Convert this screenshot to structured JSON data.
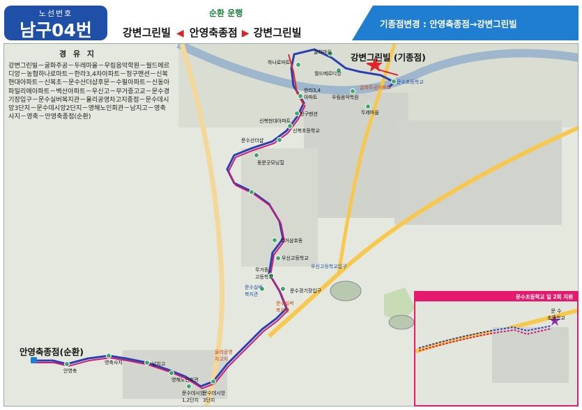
{
  "header": {
    "route_subtitle": "노선번호",
    "route_number": "남구04번",
    "loop_label": "순환 운행",
    "loop_from": "강변그린빌",
    "loop_mid": "안영축종점",
    "loop_to": "강변그린빌",
    "notice": "기종점변경 : 안영축종점→강변그린빌"
  },
  "via": {
    "title": "경 유 지",
    "text": "강변그린빌－굴화주공－두레마을－우림음악학원－월드메르디앙－농협하나로마트－한라3,4차아파트－청구맨션－신복현대아파트－신복초－문수산더샵후문－수필아파트－신동아파밀리에아파트－벽산아파트－우신고－무거중고교－문수경기장입구－문수실버복지관－율리공영차고지종점－문수데시앙3단지－문수데시앙2단지－영해노인회관－남지고－영축사지－영축－안영축종점(순환)"
  },
  "colors": {
    "route_blue": "#2b3fb0",
    "route_magenta": "#cc1c74",
    "route_red": "#e0262a",
    "badge_blue": "#1f4fa6",
    "notice_blue": "#1f7ed0",
    "inset_border": "#e5196e"
  },
  "map": {
    "start_label": "강변그린빌 (기종점)",
    "end_label": "안영축종점(순환)",
    "stops": {
      "hanaro": "하나로마트",
      "gulhwa": "굴화마을",
      "world": "월드메르디앙",
      "urim": "우림음악학원",
      "durae": "두레마을",
      "gulhwa_apt": "굴화주공아파트",
      "munsu_school": "문수초등학교",
      "halla": "한라3,4\n아파트",
      "cheonggu": "청구맨션",
      "sinbok_hyundai": "신복현대아파트",
      "sinbok_elem": "신복초등학교",
      "munsusan": "문수산더샵",
      "dongmun": "동문굿모닝힐",
      "mugeo_sam": "무거삼호동",
      "wusin": "우신고등학교",
      "wusin_ent": "우신고등학교입구",
      "mugeo_jung": "무거중,\n고등학교",
      "silver": "문수실버\n복지관",
      "silver2": "문수실버\n복지관",
      "stadium": "문수경기장입구",
      "yulli": "율리공영\n차고지",
      "desian3": "문수데시앙\n3단지",
      "desian12": "문수데시앙\n1,2단지",
      "youngae": "영해노인회관",
      "namji": "남지고",
      "youngchuksaji": "영축사지",
      "youngchuk": "안영축"
    }
  },
  "inset": {
    "title": "문수초등학교 일 2회 지원",
    "label": "문 수\n초등학교"
  }
}
